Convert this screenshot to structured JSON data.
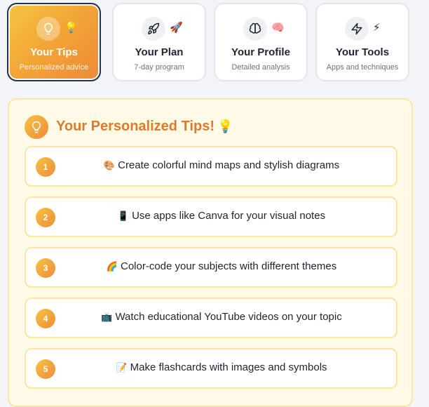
{
  "tabs": [
    {
      "title": "Your Tips",
      "subtitle": "Personalized advice",
      "icon": "lightbulb-icon",
      "emoji": "💡",
      "active": true
    },
    {
      "title": "Your Plan",
      "subtitle": "7-day program",
      "icon": "rocket-icon",
      "emoji": "🚀",
      "active": false
    },
    {
      "title": "Your Profile",
      "subtitle": "Detailed analysis",
      "icon": "brain-icon",
      "emoji": "🧠",
      "active": false
    },
    {
      "title": "Your Tools",
      "subtitle": "Apps and techniques",
      "icon": "lightning-icon",
      "emoji": "⚡",
      "active": false
    }
  ],
  "panel": {
    "title": "Your Personalized Tips!",
    "title_emoji": "💡"
  },
  "tips": [
    {
      "number": "1",
      "emoji": "🎨",
      "text": "Create colorful mind maps and stylish diagrams"
    },
    {
      "number": "2",
      "emoji": "📱",
      "text": "Use apps like Canva for your visual notes"
    },
    {
      "number": "3",
      "emoji": "🌈",
      "text": "Color-code your subjects with different themes"
    },
    {
      "number": "4",
      "emoji": "📺",
      "text": "Watch educational YouTube videos on your topic"
    },
    {
      "number": "5",
      "emoji": "📝",
      "text": "Make flashcards with images and symbols"
    }
  ],
  "colors": {
    "accent_start": "#f6c443",
    "accent_end": "#ee8a39",
    "title": "#dd7a2c",
    "panel_bg": "#fffbe6"
  }
}
